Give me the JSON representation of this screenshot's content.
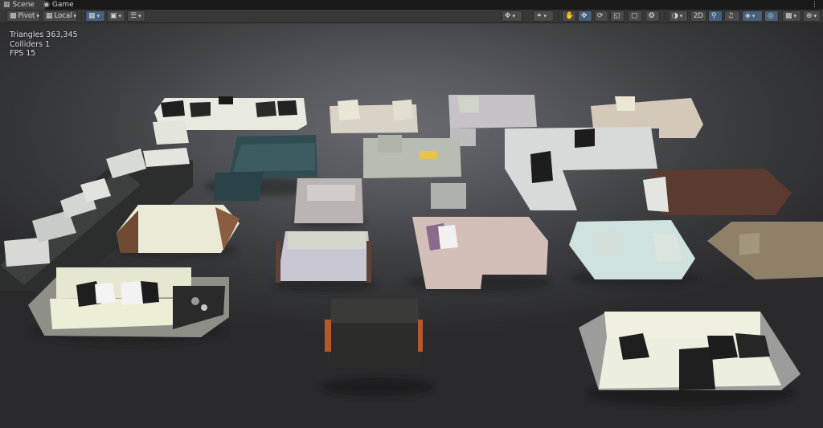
{
  "tabs": [
    {
      "label": "Scene",
      "icon": "scene-grid-icon"
    },
    {
      "label": "Game",
      "icon": "gamepad-icon"
    }
  ],
  "toolbar": {
    "pivot_label": "Pivot",
    "local_label": "Local",
    "mode_2d_label": "2D"
  },
  "stats": {
    "triangles": "Triangles 363,345",
    "colliders": "Colliders 1",
    "fps": "FPS 15"
  },
  "colors": {
    "viewport_center": "#6a6b70",
    "viewport_edge": "#2a2a2d",
    "toolbar_bg": "#383838",
    "active_toggle": "#46607c"
  }
}
